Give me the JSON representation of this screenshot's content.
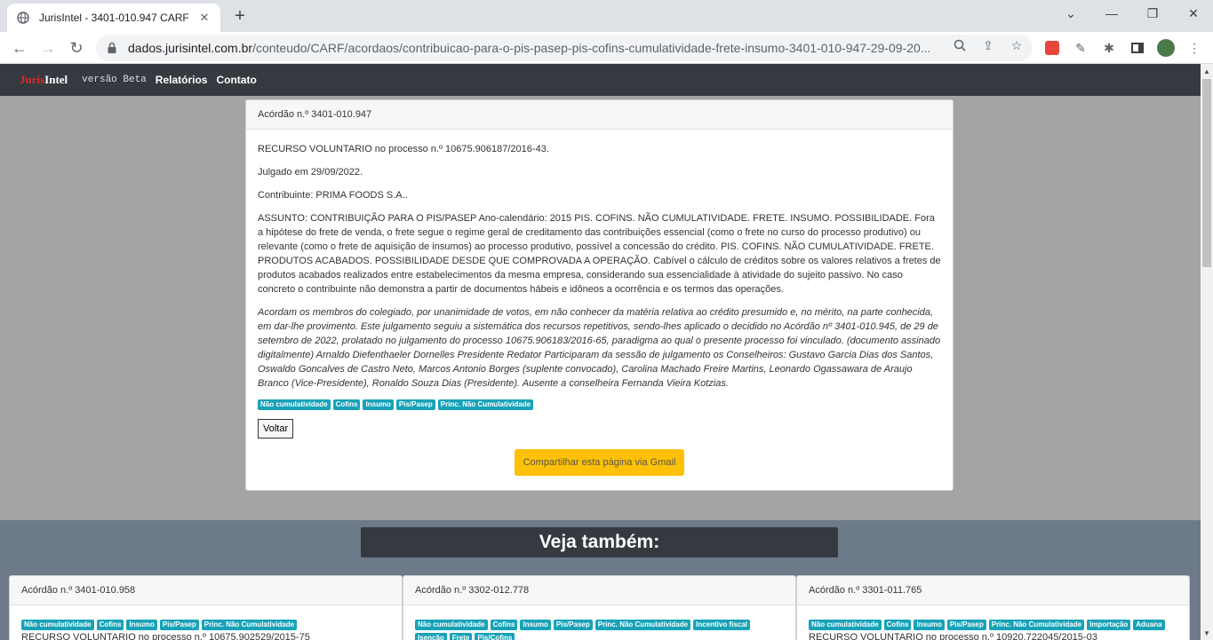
{
  "browser": {
    "tab_title": "JurisIntel - 3401-010.947 CARF",
    "url_domain": "dados.jurisintel.com.br",
    "url_path": "/conteudo/CARF/acordaos/contribuicao-para-o-pis-pasep-pis-cofins-cumulatividade-frete-insumo-3401-010-947-29-09-20..."
  },
  "nav": {
    "brand_red": "Juris",
    "brand_white": "Intel",
    "beta": "versão Beta",
    "links": [
      "Relatórios",
      "Contato"
    ]
  },
  "main": {
    "header": "Acórdão n.º 3401-010.947",
    "recurso": "RECURSO VOLUNTARIO no processo n.º 10675.906187/2016-43.",
    "julgado": "Julgado em 29/09/2022.",
    "contribuinte": "Contribuinte: PRIMA FOODS S.A..",
    "assunto": "ASSUNTO: CONTRIBUIÇÃO PARA O PIS/PASEP Ano-calendário: 2015 PIS. COFINS. NÃO CUMULATIVIDADE. FRETE. INSUMO. POSSIBILIDADE. Fora a hipótese do frete de venda, o frete segue o regime geral de creditamento das contribuições essencial (como o frete no curso do processo produtivo) ou relevante (como o frete de aquisição de insumos) ao processo produtivo, possível a concessão do crédito. PIS. COFINS. NÃO CUMULATIVIDADE. FRETE. PRODUTOS ACABADOS. POSSIBILIDADE DESDE QUE COMPROVADA A OPERAÇÃO. Cabível o cálculo de créditos sobre os valores relativos a fretes de produtos acabados realizados entre estabelecimentos da mesma empresa, considerando sua essencialidade à atividade do sujeito passivo. No caso concreto o contribuinte não demonstra a partir de documentos hábeis e idôneos a ocorrência e os termos das operações.",
    "decisao": "Acordam os membros do colegiado, por unanimidade de votos, em não conhecer da matéria relativa ao crédito presumido e, no mérito, na parte conhecida, em dar-lhe provimento. Este julgamento seguiu a sistemática dos recursos repetitivos, sendo-lhes aplicado o decidido no Acórdão nº 3401-010.945, de 29 de setembro de 2022, prolatado no julgamento do processo 10675.906183/2016-65, paradigma ao qual o presente processo foi vinculado. (documento assinado digitalmente) Arnaldo Diefenthaeler Dornelles  Presidente Redator Participaram da sessão de julgamento os Conselheiros: Gustavo Garcia Dias dos Santos, Oswaldo Goncalves de Castro Neto, Marcos Antonio Borges (suplente convocado), Carolina Machado Freire Martins, Leonardo Ogassawara de Araujo Branco (Vice-Presidente), Ronaldo Souza Dias (Presidente). Ausente a conselheira Fernanda Vieira Kotzias.",
    "tags": [
      "Não cumulatividade",
      "Cofins",
      "Insumo",
      "Pis/Pasep",
      "Princ. Não Cumulatividade"
    ],
    "voltar": "Voltar",
    "share": "Compartilhar esta página via Gmail"
  },
  "related": {
    "title": "Veja também:",
    "cards": [
      {
        "header": "Acórdão n.º 3401-010.958",
        "tags": [
          "Não cumulatividade",
          "Cofins",
          "Insumo",
          "Pis/Pasep",
          "Princ. Não Cumulatividade"
        ],
        "text": "RECURSO VOLUNTARIO no processo n.º 10675.902529/2015-75"
      },
      {
        "header": "Acórdão n.º 3302-012.778",
        "tags": [
          "Não cumulatividade",
          "Cofins",
          "Insumo",
          "Pis/Pasep",
          "Princ. Não Cumulatividade",
          "Incentivo fiscal",
          "Isenção",
          "Frete",
          "Pis/Cofins"
        ],
        "text": ""
      },
      {
        "header": "Acórdão n.º 3301-011.765",
        "tags": [
          "Não cumulatividade",
          "Cofins",
          "Insumo",
          "Pis/Pasep",
          "Princ. Não Cumulatividade",
          "Importação",
          "Aduana"
        ],
        "text": "RECURSO VOLUNTARIO no processo n.º 10920.722045/2015-03"
      }
    ]
  },
  "colors": {
    "navbar": "#343a40",
    "badge": "#17a2b8",
    "share_button": "#ffc107",
    "brand_red": "#e3262b"
  }
}
